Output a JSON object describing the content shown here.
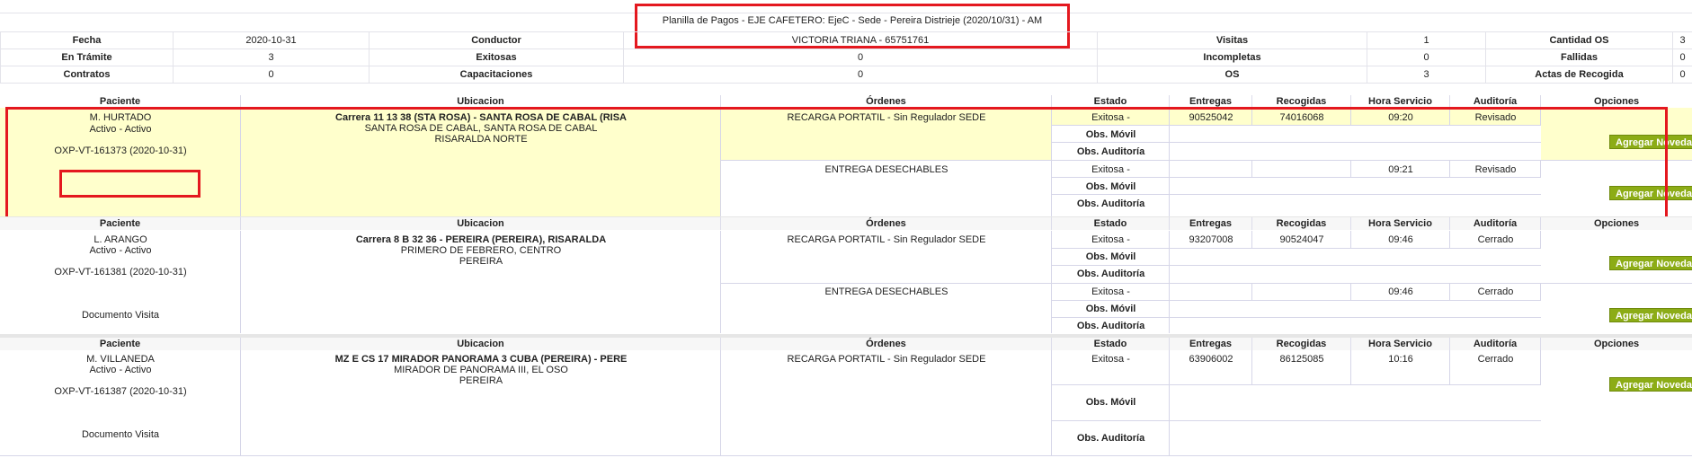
{
  "title": "Planilla de Pagos - EJE CAFETERO: EjeC - Sede - Pereira Distrieje (2020/10/31) - AM",
  "summary": {
    "rows": [
      [
        {
          "label": "Fecha",
          "value": "2020-10-31"
        },
        {
          "label": "Conductor",
          "value": "VICTORIA TRIANA - 65751761"
        },
        {
          "label": "Visitas",
          "value": "1"
        },
        {
          "label": "Cantidad OS",
          "value": "3"
        }
      ],
      [
        {
          "label": "En Trámite",
          "value": "3"
        },
        {
          "label": "Exitosas",
          "value": "0"
        },
        {
          "label": "Incompletas",
          "value": "0"
        },
        {
          "label": "Fallidas",
          "value": "0"
        }
      ],
      [
        {
          "label": "Contratos",
          "value": "0"
        },
        {
          "label": "Capacitaciones",
          "value": "0"
        },
        {
          "label": "OS",
          "value": "3"
        },
        {
          "label": "Actas de Recogida",
          "value": "0"
        }
      ]
    ]
  },
  "columns": [
    "Paciente",
    "Ubicacion",
    "Órdenes",
    "Estado",
    "Entregas",
    "Recogidas",
    "Hora Servicio",
    "Auditoría",
    "Opciones"
  ],
  "obs_movil_label": "Obs. Móvil",
  "obs_auditoria_label": "Obs. Auditoría",
  "button_label": "Agregar Novedad",
  "records": [
    {
      "patient": "M. HURTADO",
      "status": "Activo - Activo",
      "os": "OXP-VT-161373 (2020-10-31)",
      "documento": "",
      "address_line1": "Carrera 11 13 38 (STA ROSA) - SANTA ROSA DE CABAL (RISA",
      "address_line2": "SANTA ROSA DE CABAL, SANTA ROSA DE CABAL",
      "address_line3": "RISARALDA NORTE",
      "orders": [
        {
          "name": "RECARGA PORTATIL - Sin Regulador SEDE",
          "estado": "Exitosa -",
          "entregas": "90525042",
          "recogidas": "74016068",
          "hora": "09:20",
          "auditoria": "Revisado"
        },
        {
          "name": "ENTREGA DESECHABLES",
          "estado": "Exitosa -",
          "entregas": "",
          "recogidas": "",
          "hora": "09:21",
          "auditoria": "Revisado"
        }
      ]
    },
    {
      "patient": "L. ARANGO",
      "status": "Activo - Activo",
      "os": "OXP-VT-161381 (2020-10-31)",
      "documento": "Documento Visita",
      "address_line1": "Carrera 8 B 32 36 - PEREIRA (PEREIRA), RISARALDA",
      "address_line2": "PRIMERO DE FEBRERO, CENTRO",
      "address_line3": "PEREIRA",
      "orders": [
        {
          "name": "RECARGA PORTATIL - Sin Regulador SEDE",
          "estado": "Exitosa -",
          "entregas": "93207008",
          "recogidas": "90524047",
          "hora": "09:46",
          "auditoria": "Cerrado"
        },
        {
          "name": "ENTREGA DESECHABLES",
          "estado": "Exitosa -",
          "entregas": "",
          "recogidas": "",
          "hora": "09:46",
          "auditoria": "Cerrado"
        }
      ]
    },
    {
      "patient": "M. VILLANEDA",
      "status": "Activo - Activo",
      "os": "OXP-VT-161387 (2020-10-31)",
      "documento": "Documento Visita",
      "address_line1": "MZ E CS 17 MIRADOR PANORAMA 3 CUBA (PEREIRA) - PERE",
      "address_line2": "MIRADOR DE PANORAMA III, EL OSO",
      "address_line3": "PEREIRA",
      "orders": [
        {
          "name": "RECARGA PORTATIL - Sin Regulador SEDE",
          "estado": "Exitosa -",
          "entregas": "63906002",
          "recogidas": "86125085",
          "hora": "10:16",
          "auditoria": "Cerrado"
        }
      ]
    }
  ]
}
